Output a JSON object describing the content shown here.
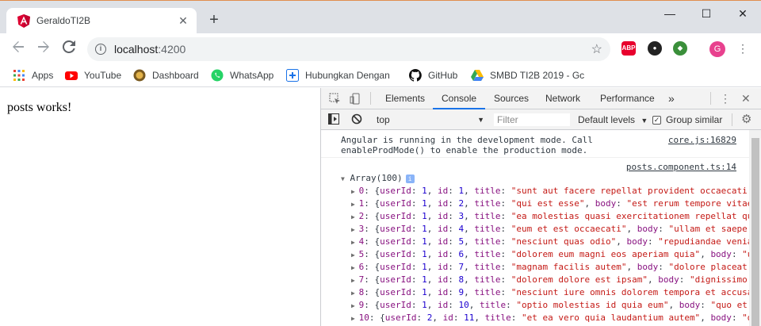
{
  "browser": {
    "tab_title": "GeraldoTI2B",
    "tab_close": "✕",
    "new_tab": "+",
    "window_controls": [
      "—",
      "☐",
      "✕"
    ],
    "url_host": "localhost",
    "url_port": ":4200"
  },
  "extensions": {
    "abp": "ABP",
    "avatar_letter": "G"
  },
  "bookmarks": [
    {
      "label": "Apps",
      "icon": "apps-grid-icon"
    },
    {
      "label": "YouTube",
      "icon": "youtube-icon"
    },
    {
      "label": "Dashboard",
      "icon": "dashboard-icon"
    },
    {
      "label": "WhatsApp",
      "icon": "whatsapp-icon"
    },
    {
      "label": "Hubungkan Dengan",
      "icon": "hubungkan-icon"
    },
    {
      "label": "GitHub",
      "icon": "github-icon"
    },
    {
      "label": "SMBD TI2B 2019 - Gc",
      "icon": "google-drive-icon"
    }
  ],
  "page": {
    "text": "posts works!"
  },
  "devtools": {
    "tabs": [
      "Elements",
      "Console",
      "Sources",
      "Network",
      "Performance"
    ],
    "active_tab": "Console",
    "more_tabs": "»",
    "context": "top",
    "filter_placeholder": "Filter",
    "levels": "Default levels",
    "group_similar": "Group similar",
    "group_similar_checked": true
  },
  "console": {
    "angular_msg_line1": "Angular is running in the development mode. Call",
    "angular_msg_line2": "enableProdMode() to enable the production mode.",
    "angular_src": "core.js:16829",
    "posts_src": "posts.component.ts:14",
    "array_label": "Array(100)",
    "array_badge": "i",
    "rows": [
      {
        "idx": "0",
        "userId": "1",
        "id": "1",
        "key": "title",
        "val": "\"sunt aut facere repellat provident occaecati"
      },
      {
        "idx": "1",
        "userId": "1",
        "id": "2",
        "key": "title",
        "val": "\"qui est esse\"",
        "key2": "body",
        "val2": "\"est rerum tempore vitae"
      },
      {
        "idx": "2",
        "userId": "1",
        "id": "3",
        "key": "title",
        "val": "\"ea molestias quasi exercitationem repellat qu"
      },
      {
        "idx": "3",
        "userId": "1",
        "id": "4",
        "key": "title",
        "val": "\"eum et est occaecati\"",
        "key2": "body",
        "val2": "\"ullam et saepe"
      },
      {
        "idx": "4",
        "userId": "1",
        "id": "5",
        "key": "title",
        "val": "\"nesciunt quas odio\"",
        "key2": "body",
        "val2": "\"repudiandae venia"
      },
      {
        "idx": "5",
        "userId": "1",
        "id": "6",
        "key": "title",
        "val": "\"dolorem eum magni eos aperiam quia\"",
        "key2": "body",
        "val2": "\"u"
      },
      {
        "idx": "6",
        "userId": "1",
        "id": "7",
        "key": "title",
        "val": "\"magnam facilis autem\"",
        "key2": "body",
        "val2": "\"dolore placeat"
      },
      {
        "idx": "7",
        "userId": "1",
        "id": "8",
        "key": "title",
        "val": "\"dolorem dolore est ipsam\"",
        "key2": "body",
        "val2": "\"dignissimo"
      },
      {
        "idx": "8",
        "userId": "1",
        "id": "9",
        "key": "title",
        "val": "\"nesciunt iure omnis dolorem tempora et accusa"
      },
      {
        "idx": "9",
        "userId": "1",
        "id": "10",
        "key": "title",
        "val": "\"optio molestias id quia eum\"",
        "key2": "body",
        "val2": "\"quo et"
      },
      {
        "idx": "10",
        "userId": "2",
        "id": "11",
        "key": "title",
        "val": "\"et ea vero quia laudantium autem\"",
        "key2": "body",
        "val2": "\"d"
      }
    ]
  },
  "colors": {
    "chrome_frame": "#dee1e6",
    "active_tab_underline": "#1a73e8",
    "json_key": "#881280",
    "json_number": "#1c00cf",
    "json_string": "#c41a16"
  }
}
